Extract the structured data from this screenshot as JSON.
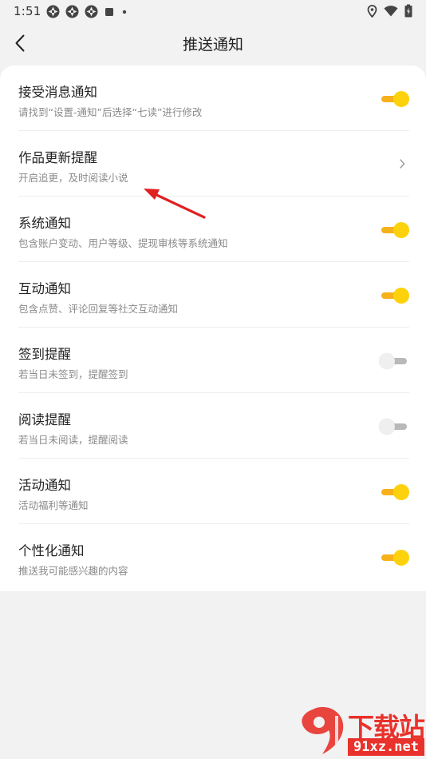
{
  "status_bar": {
    "time": "1:51",
    "left_icons": [
      "app-notification-icon",
      "app-notification-icon",
      "app-notification-icon",
      "square-notification-icon",
      "dot-icon"
    ],
    "right_icons": [
      "location-icon",
      "wifi-icon",
      "battery-icon"
    ]
  },
  "nav": {
    "title": "推送通知",
    "back_icon": "back-chevron-icon"
  },
  "settings": [
    {
      "id": "accept-messages",
      "title": "接受消息通知",
      "subtitle": "请找到“设置-通知”后选择“七读”进行修改",
      "control": "toggle",
      "on": true
    },
    {
      "id": "work-updates",
      "title": "作品更新提醒",
      "subtitle": "开启追更，及时阅读小说",
      "control": "chevron"
    },
    {
      "id": "system",
      "title": "系统通知",
      "subtitle": "包含账户变动、用户等级、提现审核等系统通知",
      "control": "toggle",
      "on": true
    },
    {
      "id": "interaction",
      "title": "互动通知",
      "subtitle": "包含点赞、评论回复等社交互动通知",
      "control": "toggle",
      "on": true
    },
    {
      "id": "checkin",
      "title": "签到提醒",
      "subtitle": "若当日未签到，提醒签到",
      "control": "toggle",
      "on": false
    },
    {
      "id": "reading",
      "title": "阅读提醒",
      "subtitle": "若当日未阅读，提醒阅读",
      "control": "toggle",
      "on": false
    },
    {
      "id": "activity",
      "title": "活动通知",
      "subtitle": "活动福利等通知",
      "control": "toggle",
      "on": true
    },
    {
      "id": "personalized",
      "title": "个性化通知",
      "subtitle": "推送我可能感兴趣的内容",
      "control": "toggle",
      "on": true
    }
  ],
  "colors": {
    "toggle_on_knob": "#fdd20c",
    "toggle_on_track": "#f6b11a",
    "toggle_off_track": "#b9b9b9",
    "annotation_arrow": "#e02020",
    "watermark": "#e8322b"
  },
  "watermark": {
    "title": "下载站",
    "url": "91xz.net"
  }
}
